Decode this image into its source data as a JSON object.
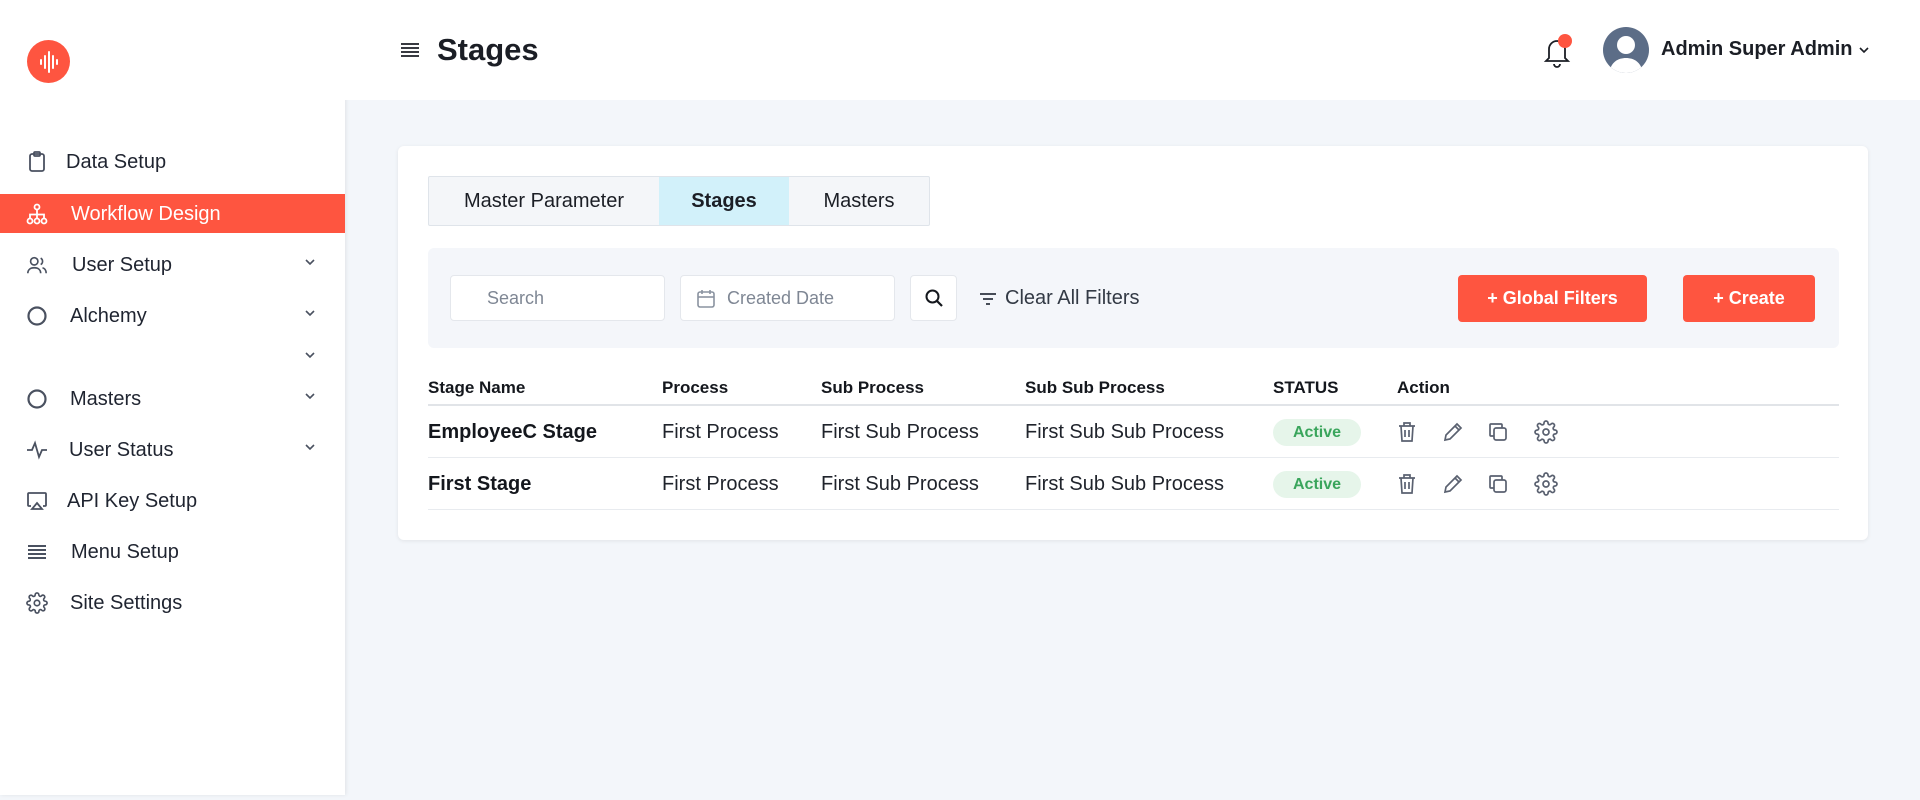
{
  "sidebar": {
    "items": [
      {
        "label": "Data Setup",
        "icon": "clipboard-icon",
        "chevron": false,
        "active": false
      },
      {
        "label": "Workflow Design",
        "icon": "hierarchy-icon",
        "chevron": false,
        "active": true
      },
      {
        "label": "User Setup",
        "icon": "users-icon",
        "chevron": true,
        "active": false
      },
      {
        "label": "Alchemy",
        "icon": "circle-icon",
        "chevron": true,
        "active": false
      },
      {
        "label": "",
        "icon": "",
        "chevron": true,
        "active": false
      },
      {
        "label": "Masters",
        "icon": "circle-icon",
        "chevron": true,
        "active": false
      },
      {
        "label": "User Status",
        "icon": "activity-icon",
        "chevron": true,
        "active": false
      },
      {
        "label": "API Key Setup",
        "icon": "airplay-icon",
        "chevron": false,
        "active": false
      },
      {
        "label": "Menu Setup",
        "icon": "list-icon",
        "chevron": false,
        "active": false
      },
      {
        "label": "Site Settings",
        "icon": "gear-icon",
        "chevron": false,
        "active": false
      }
    ]
  },
  "header": {
    "title": "Stages",
    "user_name": "Admin Super Admin"
  },
  "tabs": [
    {
      "label": "Master Parameter",
      "active": false
    },
    {
      "label": "Stages",
      "active": true
    },
    {
      "label": "Masters",
      "active": false
    }
  ],
  "filters": {
    "search_placeholder": "Search",
    "date_placeholder": "Created Date",
    "clear_label": "Clear All Filters",
    "global_filters_label": "+ Global Filters",
    "create_label": "+ Create"
  },
  "table": {
    "columns": [
      "Stage Name",
      "Process",
      "Sub Process",
      "Sub Sub Process",
      "STATUS",
      "Action"
    ],
    "rows": [
      {
        "stage_name": "EmployeeC Stage",
        "process": "First Process",
        "sub_process": "First Sub Process",
        "sub_sub_process": "First Sub Sub Process",
        "status": "Active"
      },
      {
        "stage_name": "First Stage",
        "process": "First Process",
        "sub_process": "First Sub Process",
        "sub_sub_process": "First Sub Sub Process",
        "status": "Active"
      }
    ]
  },
  "colors": {
    "accent": "#fe5540",
    "active_tab": "#d2f1fa",
    "status_active_bg": "#e6f5ea",
    "status_active_text": "#3aa55c"
  }
}
